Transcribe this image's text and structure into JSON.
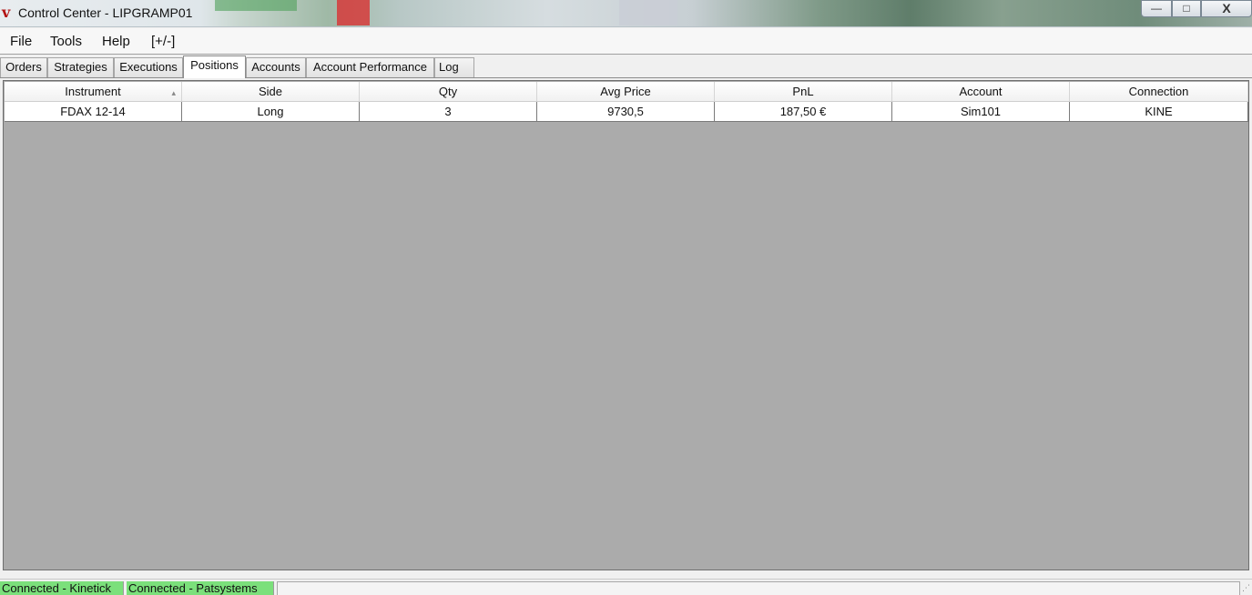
{
  "window": {
    "title": "Control Center - LIPGRAMP01",
    "logo_glyph": "v",
    "controls": {
      "minimize": "—",
      "maximize": "□",
      "close": "X"
    }
  },
  "menu": [
    {
      "label": "File"
    },
    {
      "label": "Tools"
    },
    {
      "label": "Help"
    },
    {
      "label": "[+/-]"
    }
  ],
  "tabs": [
    {
      "label": "Orders",
      "active": false
    },
    {
      "label": "Strategies",
      "active": false
    },
    {
      "label": "Executions",
      "active": false
    },
    {
      "label": "Positions",
      "active": true
    },
    {
      "label": "Accounts",
      "active": false
    },
    {
      "label": "Account Performance",
      "active": false
    },
    {
      "label": "Log",
      "active": false
    }
  ],
  "positions": {
    "columns": [
      "Instrument",
      "Side",
      "Qty",
      "Avg Price",
      "PnL",
      "Account",
      "Connection"
    ],
    "sorted_column_glyph": "▴",
    "rows": [
      [
        "FDAX 12-14",
        "Long",
        "3",
        "9730,5",
        "187,50 €",
        "Sim101",
        "KINE"
      ]
    ]
  },
  "status": {
    "segments": [
      "Connected - Kinetick",
      "Connected - Patsystems"
    ],
    "ok_color": "#7be07b",
    "grip_glyph": "⋰"
  }
}
